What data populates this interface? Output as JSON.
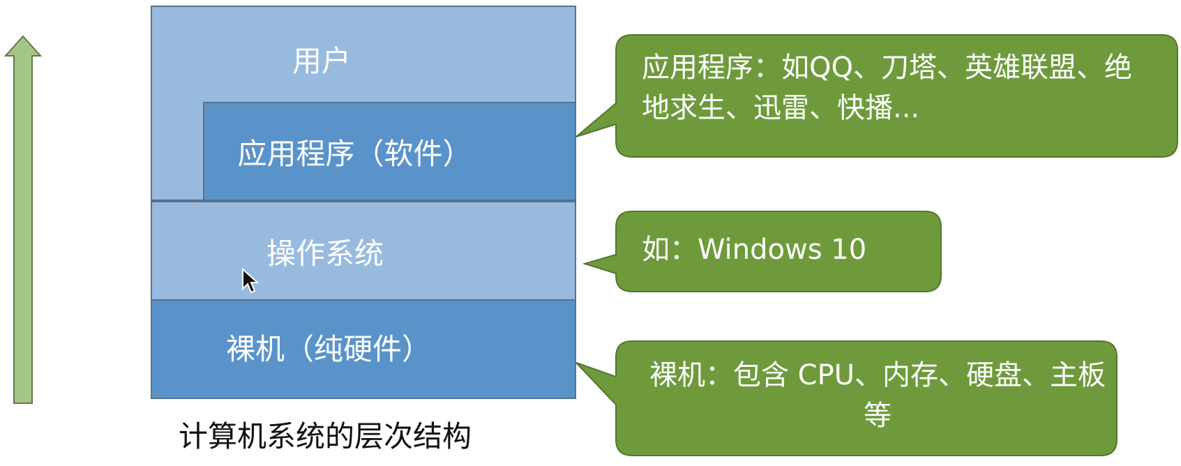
{
  "diagram": {
    "caption": "计算机系统的层次结构",
    "layers": {
      "user": "用户",
      "application": "应用程序（软件）",
      "os": "操作系统",
      "hardware": "裸机（纯硬件）"
    }
  },
  "callouts": {
    "application": "应用程序：如QQ、刀塔、英雄联盟、绝地求生、迅雷、快播...",
    "os": "如：Windows 10",
    "hardware": "裸机：包含 CPU、内存、硬盘、主板等"
  },
  "colors": {
    "light_layer": "#98badf",
    "dark_layer": "#5a93c9",
    "callout_fill": "#6e9a3c",
    "arrow_fill": "#a3c585"
  },
  "icons": {
    "arrow": "up-arrow-icon",
    "cursor": "mouse-pointer-icon"
  }
}
